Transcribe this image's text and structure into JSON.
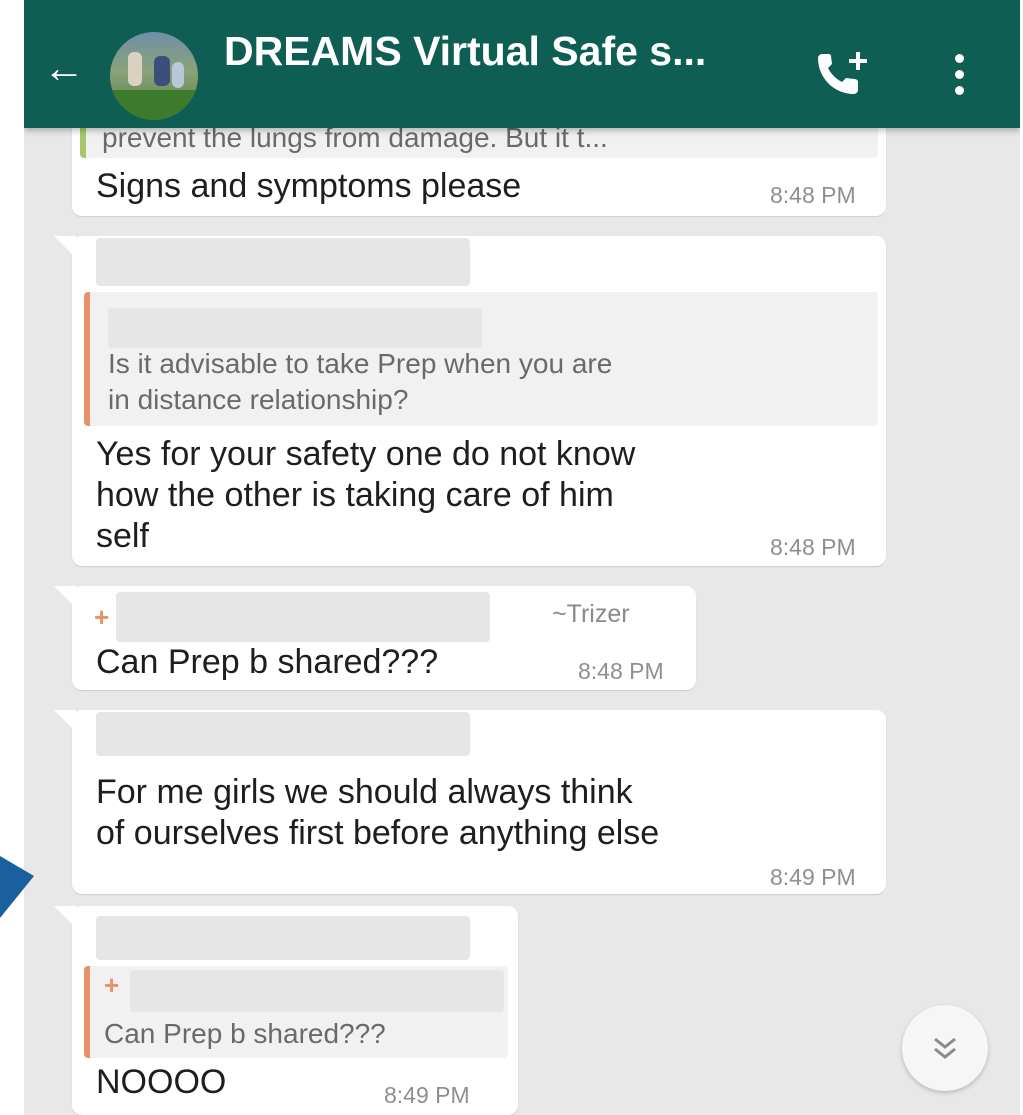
{
  "header": {
    "title": "DREAMS Virtual Safe s...",
    "back_icon": "arrow-left-icon",
    "call_icon": "add-call-icon",
    "menu_icon": "more-vert-icon",
    "color": "#0f5e54"
  },
  "messages": [
    {
      "quote": "prevent the lungs from damage. But it t...",
      "text": "Signs and symptoms please",
      "time": "8:48 PM"
    },
    {
      "quote": "Is it advisable to take Prep when you are in distance relationship?",
      "quote_line1": "Is it advisable to take Prep when you are",
      "quote_line2": "in distance relationship?",
      "text_line1": "Yes for your safety one do not know",
      "text_line2": "how the other is taking care of him",
      "text_line3": "self",
      "time": "8:48 PM"
    },
    {
      "sender": "~Trizer",
      "plus": "+",
      "text": "Can Prep b shared???",
      "time": "8:48 PM"
    },
    {
      "text_line1": "For me girls we should always think",
      "text_line2": "of ourselves first before anything else",
      "time": "8:49 PM"
    },
    {
      "plus": "+",
      "quote": "Can Prep b shared???",
      "text": "NOOOO",
      "time": "8:49 PM"
    }
  ],
  "scroll_button_icon": "double-chevron-down-icon",
  "quote_bar_color": "#e8926a"
}
